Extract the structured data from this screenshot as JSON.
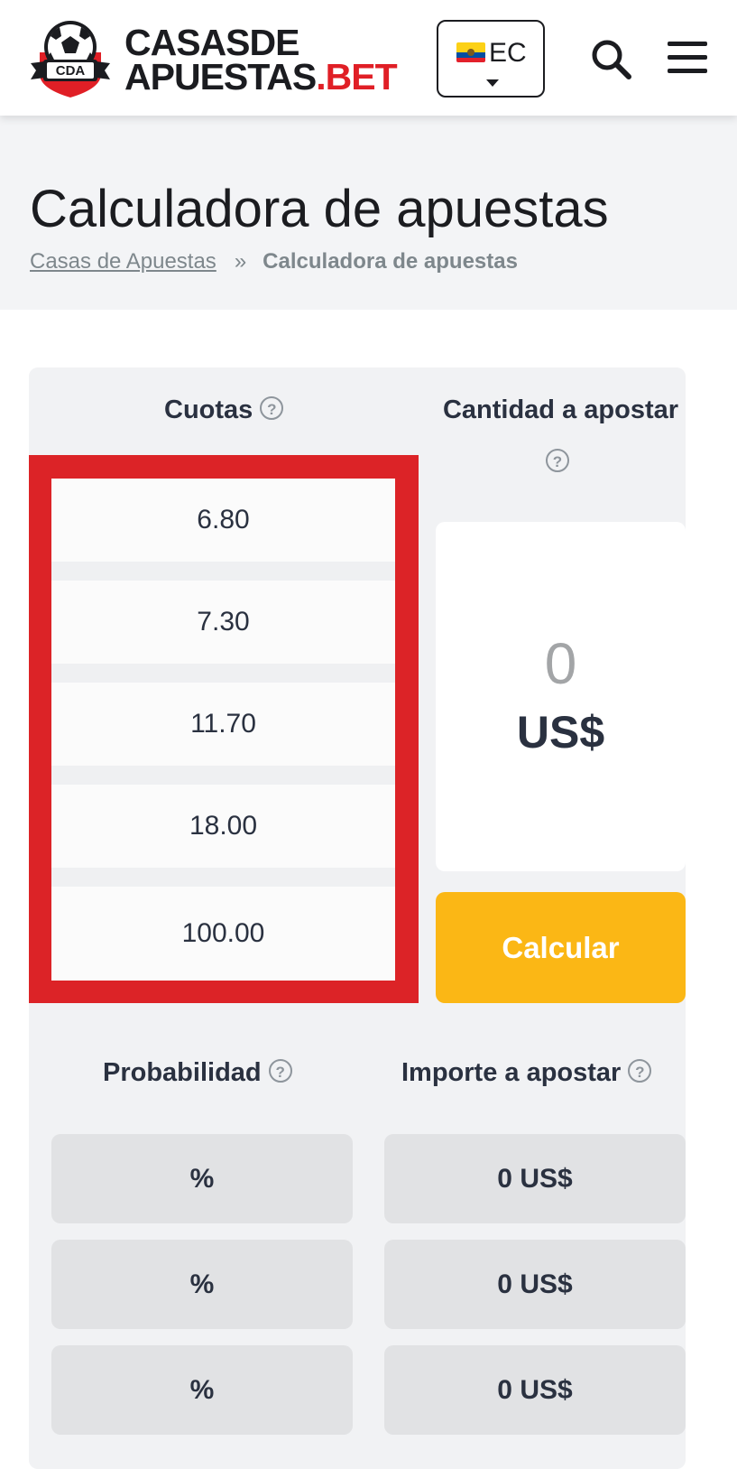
{
  "header": {
    "logo": {
      "badge_text": "CDA",
      "line1_a": "CASAS",
      "line1_b": "DE",
      "line2_a": "APUESTAS",
      "line2_b": ".BET"
    },
    "country": {
      "code": "EC",
      "flag_icon": "ecuador-flag-icon"
    },
    "search_icon": "search-icon",
    "menu_icon": "hamburger-menu-icon"
  },
  "hero": {
    "title": "Calculadora de apuestas",
    "breadcrumb": {
      "home": "Casas de Apuestas",
      "separator": "»",
      "current": "Calculadora de apuestas"
    }
  },
  "calculator": {
    "odds_label": "Cuotas",
    "stake_label": "Cantidad a apostar",
    "help_glyph": "?",
    "odds": [
      "6.80",
      "7.30",
      "11.70",
      "18.00",
      "100.00"
    ],
    "stake_value": "0",
    "currency": "US$",
    "calculate_label": "Calcular",
    "probability_label": "Probabilidad",
    "amount_label": "Importe a apostar",
    "results": [
      {
        "probability": "%",
        "amount": "0 US$"
      },
      {
        "probability": "%",
        "amount": "0 US$"
      },
      {
        "probability": "%",
        "amount": "0 US$"
      }
    ]
  },
  "colors": {
    "highlight": "#dc2327",
    "calculate_button": "#fbb715",
    "logo_red": "#e01f26",
    "card_bg": "#f1f2f4"
  }
}
